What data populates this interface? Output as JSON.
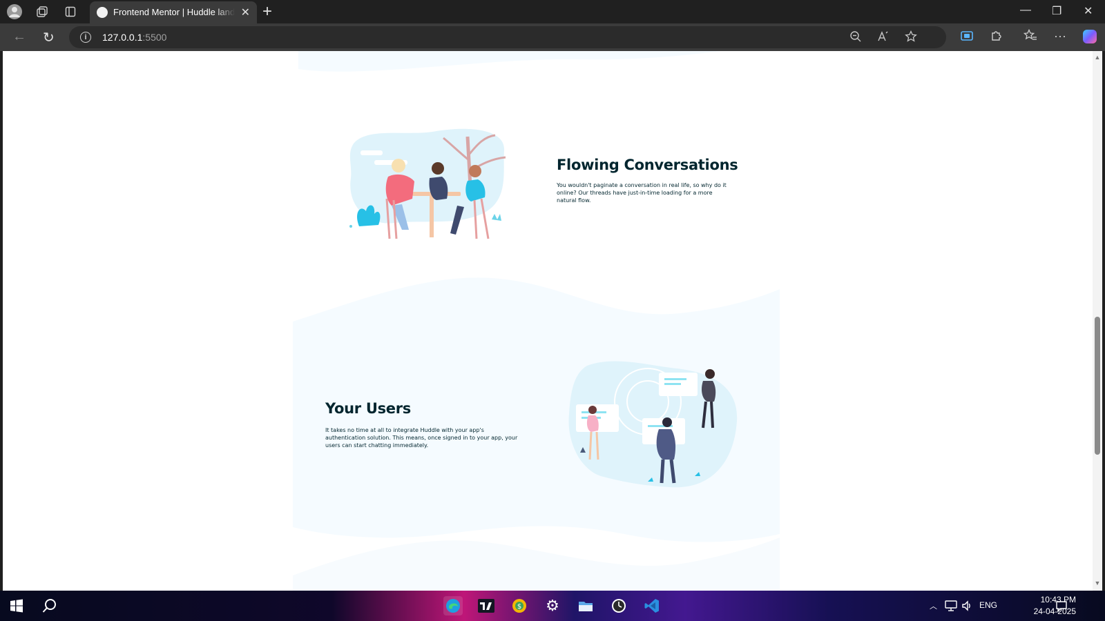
{
  "browser": {
    "tab": {
      "title": "Frontend Mentor | Huddle landing page"
    },
    "address": {
      "host": "127.0.0.1",
      "port": ":5500"
    }
  },
  "page": {
    "features": [
      {
        "title": "Flowing Conversations",
        "text": "You wouldn't paginate a conversation in real life, so why do it online? Our threads have just-in-time loading for a more natural flow."
      },
      {
        "title": "Your Users",
        "text": "It takes no time at all to integrate Huddle with your app's authentication solution. This means, once signed in to your app, your users can start chatting immediately."
      }
    ]
  },
  "taskbar": {
    "language": "ENG",
    "time": "10:43 PM",
    "date": "24-04-2025",
    "apps": [
      "windows-start",
      "search",
      "edge",
      "tradingview",
      "metatrader",
      "settings",
      "file-explorer",
      "clock",
      "vscode"
    ]
  },
  "colors": {
    "heading": "#00252e",
    "section_bg": "#f5fbff",
    "accent": "#00bcd4"
  }
}
